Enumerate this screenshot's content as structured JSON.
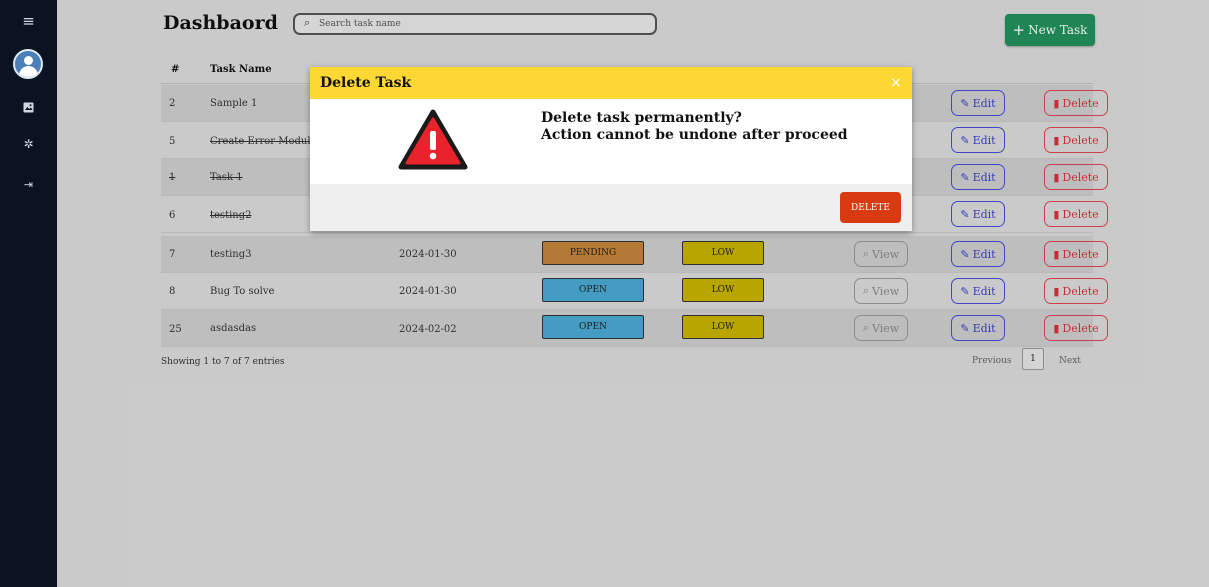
{
  "app": {
    "title": "Dashbaord",
    "search_placeholder": "Search task name",
    "new_task_label": "New Task"
  },
  "icons": {
    "menu": "hamburger-icon",
    "profile": "user-avatar-icon",
    "image": "image-icon",
    "settings": "gear-icon",
    "logout": "sign-out-icon",
    "search": "search-icon",
    "plus": "plus-icon",
    "view": "search-icon",
    "edit": "edit-icon",
    "delete": "trash-icon",
    "warning": "warning-triangle-icon",
    "close": "close-icon"
  },
  "colors": {
    "sidebar": "#0b1221",
    "accent_green": "#22915c",
    "modal_header": "#fdd835",
    "delete_button": "#d83a12",
    "pending": "#c4853a",
    "open": "#4aaad3",
    "low": "#c8b400",
    "edit": "#4b4dd6",
    "delete": "#e04555"
  },
  "table": {
    "headers": {
      "num": "#",
      "name": "Task Name"
    },
    "actions": {
      "view": "View",
      "edit": "Edit",
      "delete": "Delete"
    },
    "rows": [
      {
        "num": "2",
        "name": "Sample 1",
        "date": "",
        "status": "",
        "priority": ""
      },
      {
        "num": "5",
        "name": "Create Error Module",
        "date": "",
        "status": "",
        "priority": ""
      },
      {
        "num": "1",
        "name": "Task 1",
        "date": "",
        "status": "",
        "priority": ""
      },
      {
        "num": "6",
        "name": "testing2",
        "date": "",
        "status": "",
        "priority": ""
      },
      {
        "num": "7",
        "name": "testing3",
        "date": "2024-01-30",
        "status": "PENDING",
        "priority": "LOW"
      },
      {
        "num": "8",
        "name": "Bug To solve",
        "date": "2024-01-30",
        "status": "OPEN",
        "priority": "LOW"
      },
      {
        "num": "25",
        "name": "asdasdas",
        "date": "2024-02-02",
        "status": "OPEN",
        "priority": "LOW"
      }
    ]
  },
  "footer": {
    "entries": "Showing 1 to 7 of 7 entries",
    "previous": "Previous",
    "page": "1",
    "next": "Next"
  },
  "modal": {
    "title": "Delete Task",
    "close": "×",
    "line1": "Delete task permanently?",
    "line2": "Action cannot be undone after proceed",
    "confirm": "DELETE"
  }
}
